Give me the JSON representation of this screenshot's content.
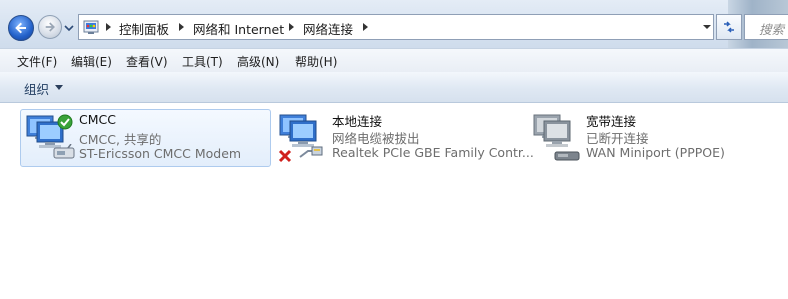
{
  "address_bar": {
    "breadcrumbs": [
      "控制面板",
      "网络和 Internet",
      "网络连接"
    ],
    "search_placeholder": "搜索"
  },
  "menu": {
    "items": [
      "文件(F)",
      "编辑(E)",
      "查看(V)",
      "工具(T)",
      "高级(N)",
      "帮助(H)"
    ]
  },
  "command_bar": {
    "organize_label": "组织"
  },
  "connections": [
    {
      "name": "CMCC",
      "status": "CMCC, 共享的",
      "device": "ST-Ericsson CMCC Modem",
      "state": "connected",
      "selected": true
    },
    {
      "name": "本地连接",
      "status": "网络电缆被拔出",
      "device": "Realtek PCIe GBE Family Contr...",
      "state": "cable-unplugged",
      "selected": false
    },
    {
      "name": "宽带连接",
      "status": "已断开连接",
      "device": "WAN Miniport (PPPOE)",
      "state": "disconnected",
      "selected": false
    }
  ],
  "colors": {
    "accent": "#2361c9",
    "selection_bg": "#e3eefb",
    "selection_border": "#aecbee",
    "status_text": "#6d6d6d",
    "connected_check": "#3aa33a",
    "unplugged_x": "#d0201c"
  },
  "icons": {
    "back": "back-arrow-icon",
    "forward": "forward-arrow-icon",
    "folder": "control-panel-icon",
    "refresh": "refresh-icon",
    "connection": "network-connection-icon",
    "connected": "check-badge-icon",
    "unplugged": "red-x-icon",
    "modem": "modem-icon",
    "cable": "network-cable-icon",
    "dialup": "dialup-device-icon"
  }
}
